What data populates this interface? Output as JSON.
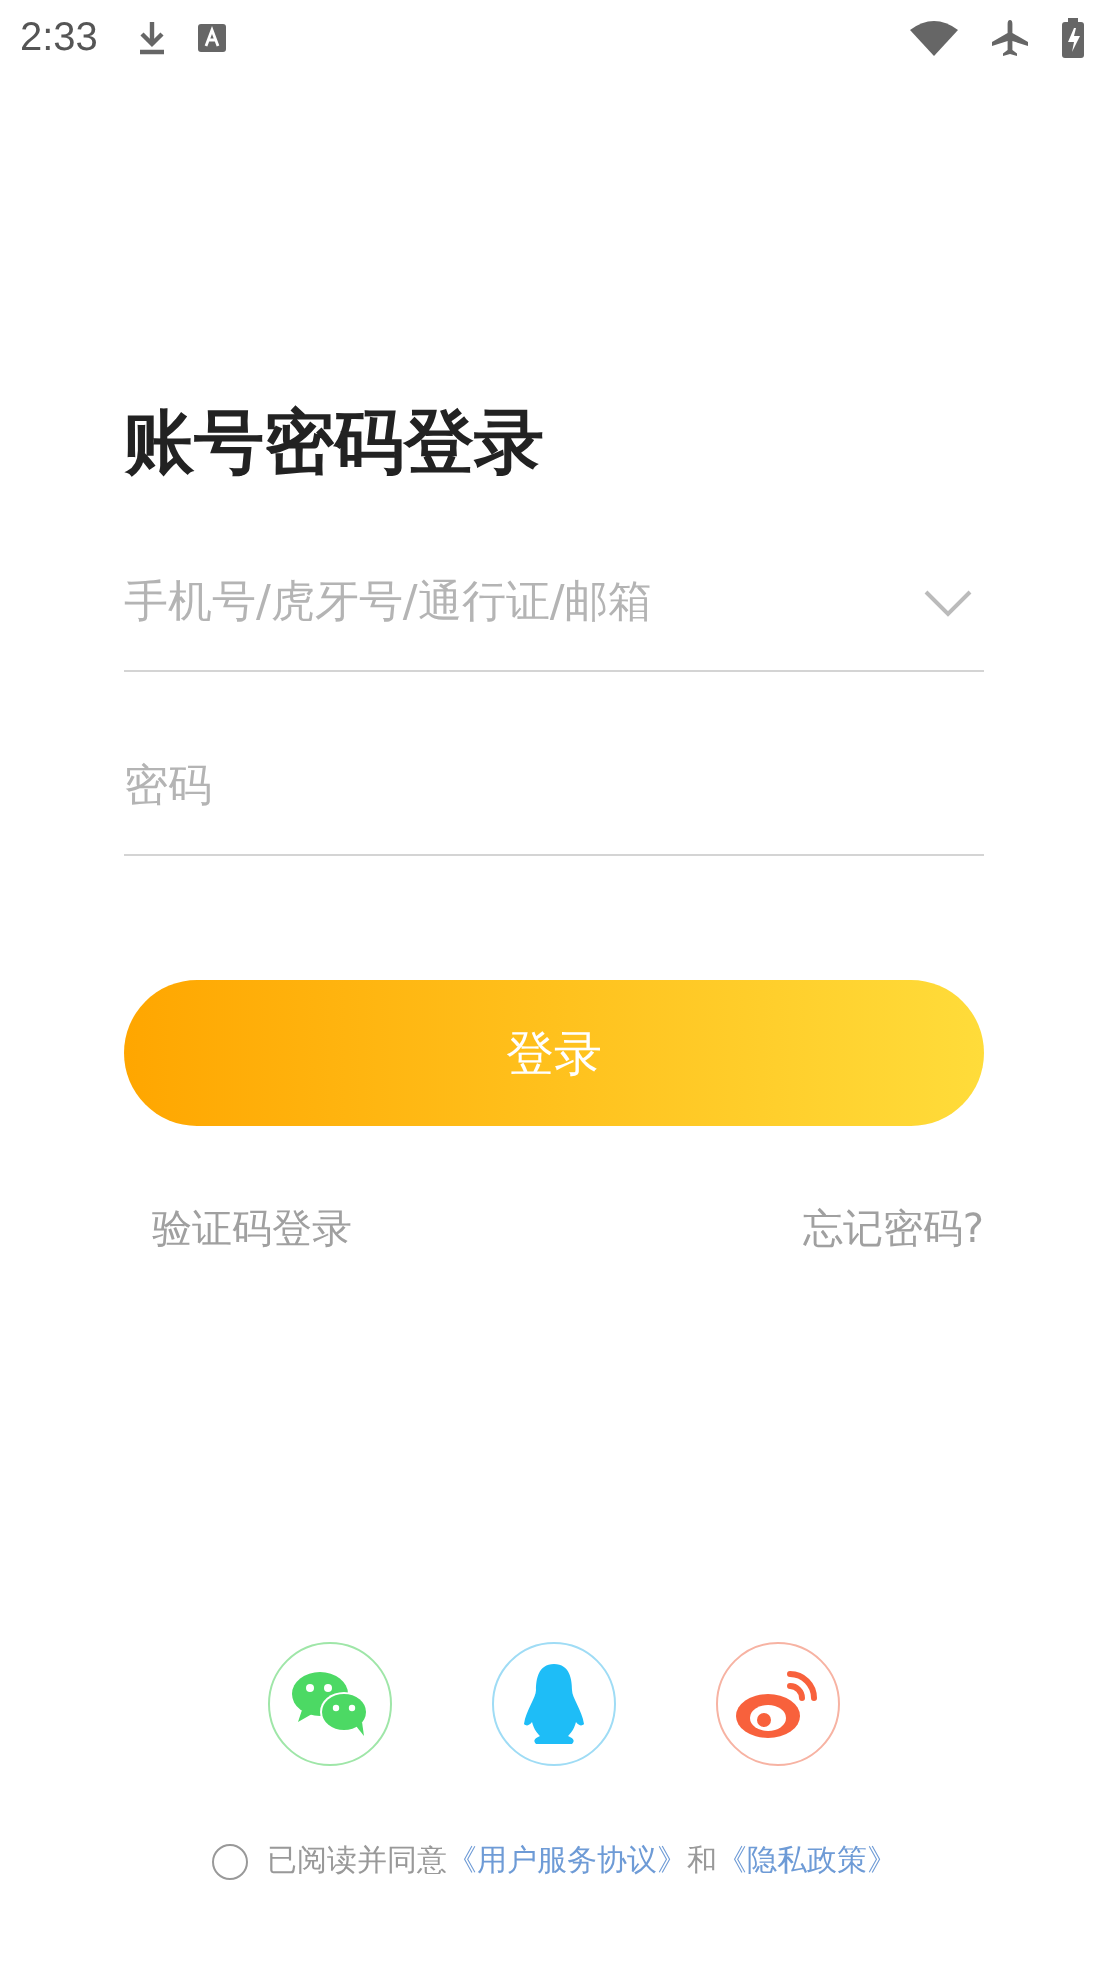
{
  "status_bar": {
    "time": "2:33"
  },
  "title": "账号密码登录",
  "account_field": {
    "placeholder": "手机号/虎牙号/通行证/邮箱"
  },
  "password_field": {
    "placeholder": "密码"
  },
  "login_button": "登录",
  "sms_login_link": "验证码登录",
  "forgot_password_link": "忘记密码?",
  "social_logins": [
    {
      "kind": "wechat"
    },
    {
      "kind": "qq"
    },
    {
      "kind": "weibo"
    }
  ],
  "agreement": {
    "checked": false,
    "prefix": "已阅读并同意",
    "terms_link": "《用户服务协议》",
    "conjunction": "和",
    "privacy_link": "《隐私政策》"
  }
}
